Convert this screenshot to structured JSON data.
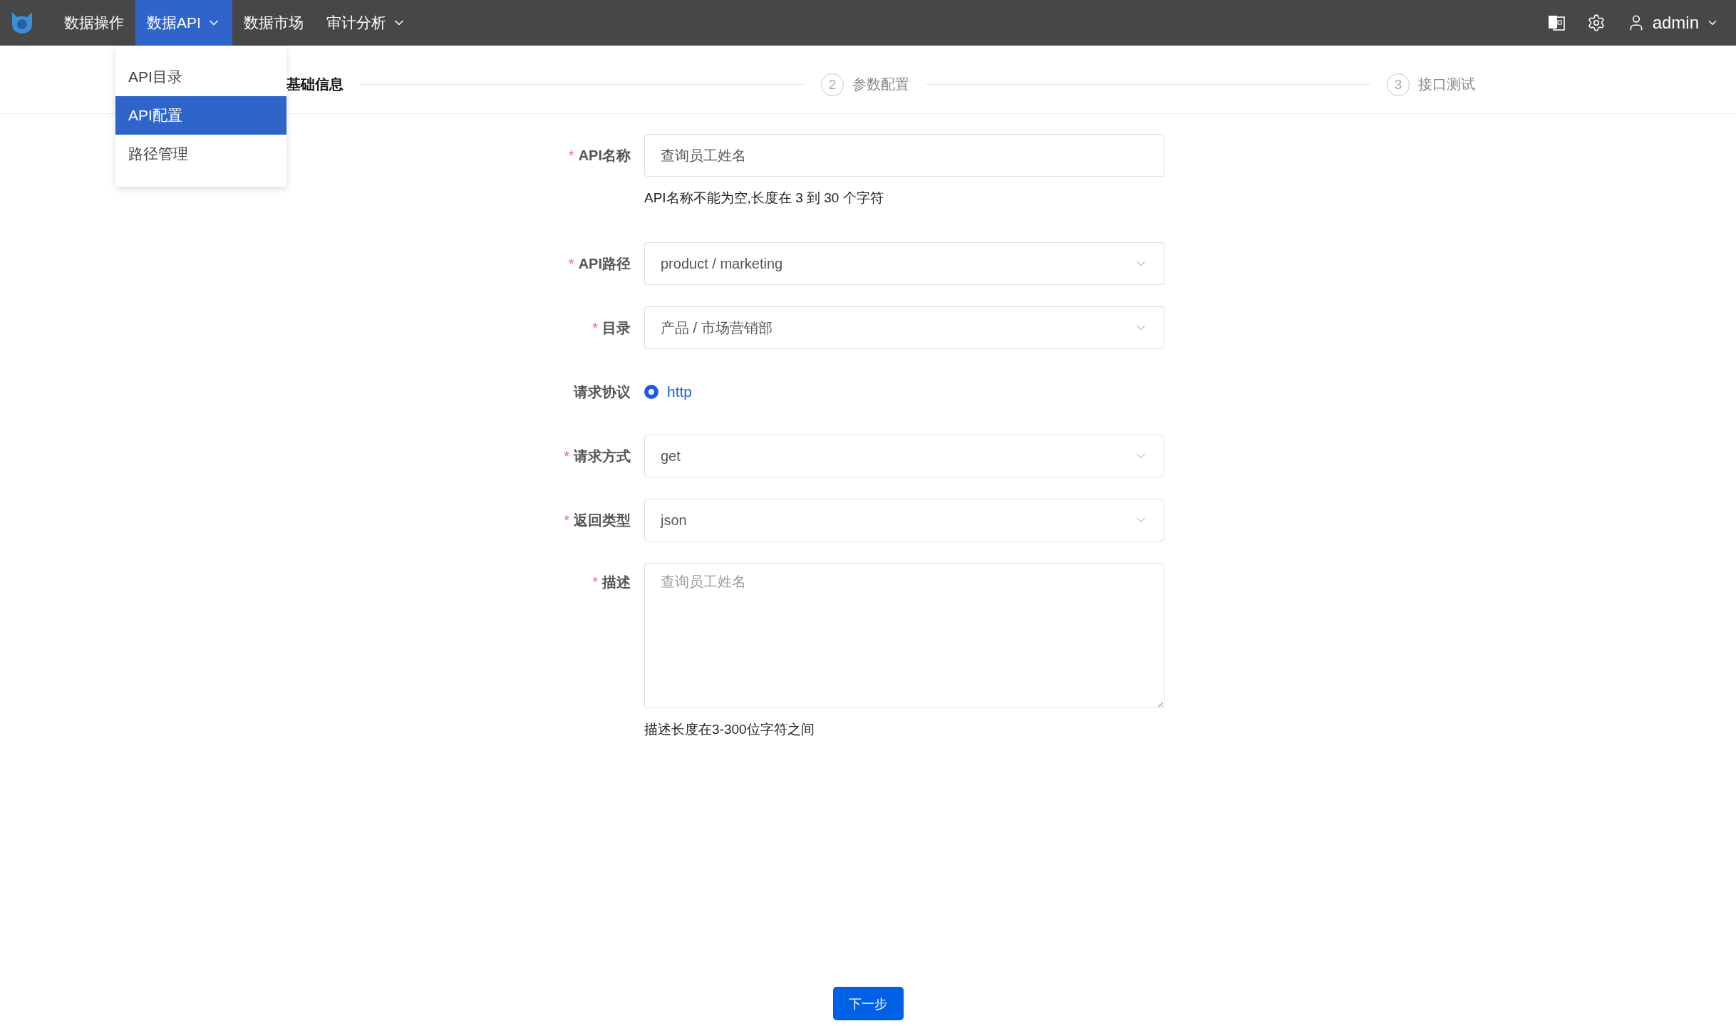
{
  "nav": {
    "items": [
      {
        "label": "数据操作",
        "selected": false,
        "dropdown": false
      },
      {
        "label": "数据API",
        "selected": true,
        "dropdown": true
      },
      {
        "label": "数据市场",
        "selected": false,
        "dropdown": false
      },
      {
        "label": "审计分析",
        "selected": false,
        "dropdown": true
      }
    ],
    "user": "admin"
  },
  "dropdown_menu": {
    "items": [
      {
        "label": "API目录",
        "selected": false
      },
      {
        "label": "API配置",
        "selected": true
      },
      {
        "label": "路径管理",
        "selected": false
      }
    ]
  },
  "steps": [
    {
      "label": "基础信息",
      "selected": true
    },
    {
      "number": "2",
      "label": "参数配置",
      "selected": false
    },
    {
      "number": "3",
      "label": "接口测试",
      "selected": false
    }
  ],
  "form": {
    "required_mark": "*",
    "fields": [
      {
        "kind": "input",
        "label": "API名称",
        "required": true,
        "value": "查询员工姓名",
        "hint": "API名称不能为空,长度在 3 到 30 个字符"
      },
      {
        "kind": "select",
        "label": "API路径",
        "required": true,
        "value": "product / marketing"
      },
      {
        "kind": "select",
        "label": "目录",
        "required": true,
        "value": "产品 / 市场营销部"
      },
      {
        "kind": "radio",
        "label": "请求协议",
        "required": false,
        "options": [
          {
            "label": "http",
            "selected": true
          }
        ]
      },
      {
        "kind": "select",
        "label": "请求方式",
        "required": true,
        "value": "get"
      },
      {
        "kind": "select",
        "label": "返回类型",
        "required": true,
        "value": "json"
      },
      {
        "kind": "textarea",
        "label": "描述",
        "required": true,
        "placeholder": "查询员工姓名",
        "hint": "描述长度在3-300位字符之间"
      }
    ]
  },
  "next_button": "下一步"
}
